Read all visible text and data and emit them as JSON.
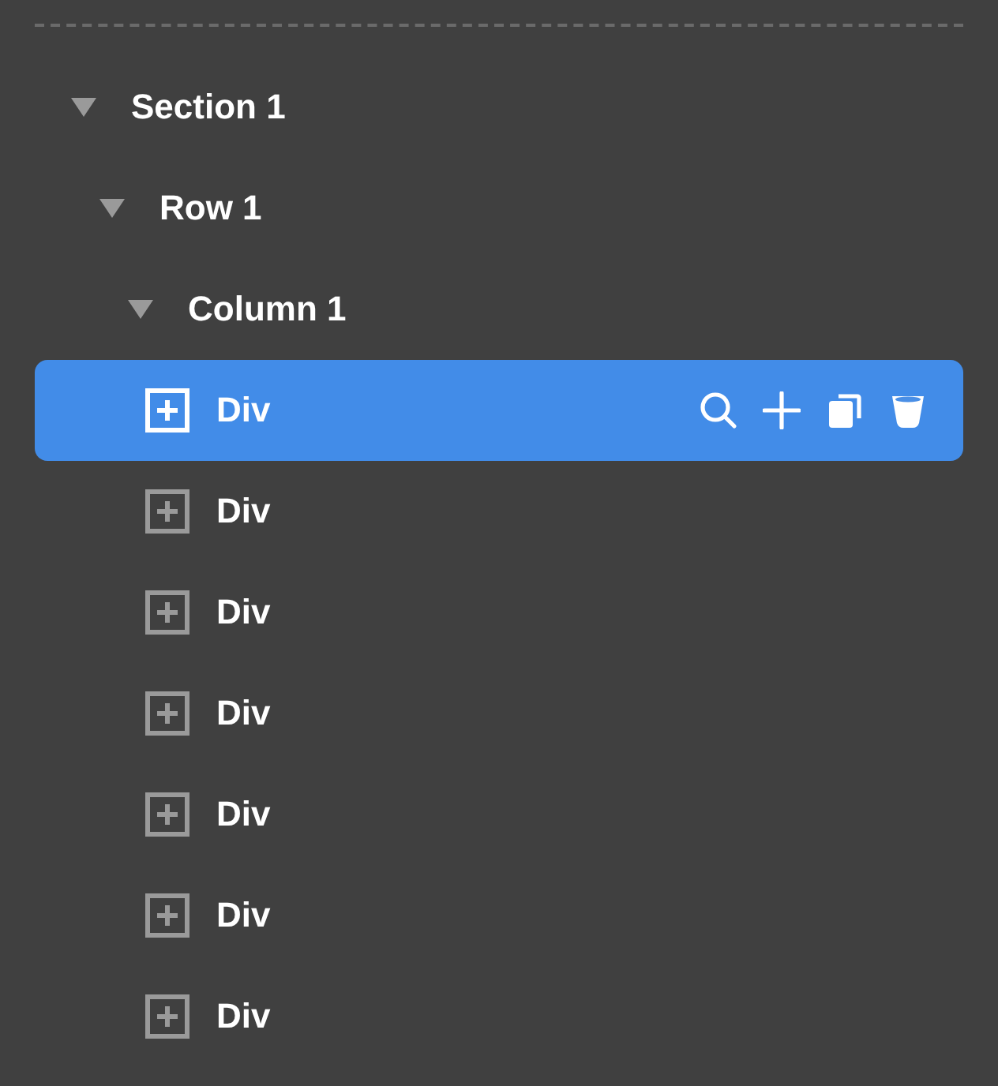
{
  "tree": [
    {
      "kind": "group",
      "label": "Section 1",
      "expanded": true,
      "selected": false,
      "children": [
        {
          "kind": "group",
          "label": "Row 1",
          "expanded": true,
          "selected": false,
          "children": [
            {
              "kind": "group",
              "label": "Column 1",
              "expanded": true,
              "selected": false,
              "children": [
                {
                  "kind": "element",
                  "label": "Div",
                  "selected": true
                },
                {
                  "kind": "element",
                  "label": "Div",
                  "selected": false
                },
                {
                  "kind": "element",
                  "label": "Div",
                  "selected": false
                },
                {
                  "kind": "element",
                  "label": "Div",
                  "selected": false
                },
                {
                  "kind": "element",
                  "label": "Div",
                  "selected": false
                },
                {
                  "kind": "element",
                  "label": "Div",
                  "selected": false
                },
                {
                  "kind": "element",
                  "label": "Div",
                  "selected": false
                }
              ]
            }
          ]
        }
      ]
    }
  ]
}
